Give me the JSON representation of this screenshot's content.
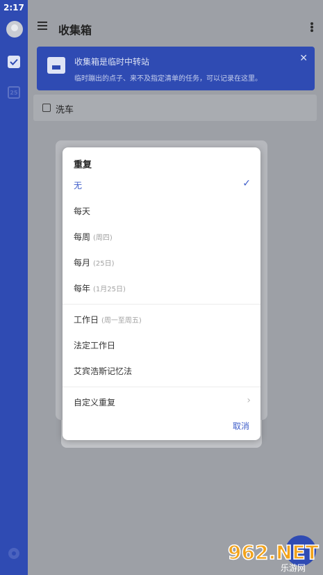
{
  "status_bar": {
    "time": "2:17"
  },
  "sidebar": {
    "calendar_day": "25"
  },
  "header": {
    "title": "收集箱"
  },
  "banner": {
    "title": "收集箱是临时中转站",
    "description": "临时蹦出的点子、来不及指定清单的任务，可以记录在这里。"
  },
  "tasks": [
    {
      "label": "洗车",
      "checked": false
    }
  ],
  "dialog": {
    "title": "重复",
    "options": [
      {
        "label": "无",
        "hint": "",
        "selected": true
      },
      {
        "label": "每天",
        "hint": "",
        "selected": false
      },
      {
        "label": "每周",
        "hint": "(周四)",
        "selected": false
      },
      {
        "label": "每月",
        "hint": "(25日)",
        "selected": false
      },
      {
        "label": "每年",
        "hint": "(1月25日)",
        "selected": false
      },
      {
        "label": "工作日",
        "hint": "(周一至周五)",
        "selected": false
      },
      {
        "label": "法定工作日",
        "hint": "",
        "selected": false
      },
      {
        "label": "艾宾浩斯记忆法",
        "hint": "",
        "selected": false
      },
      {
        "label": "自定义重复",
        "hint": "",
        "selected": false
      }
    ],
    "cancel_label": "取消"
  },
  "watermark": {
    "text": "962.NET",
    "subtext": "乐游网"
  },
  "colors": {
    "brand": "#2f4bb3",
    "accent": "#3d5cc9",
    "overlay": "#9da0a6"
  }
}
